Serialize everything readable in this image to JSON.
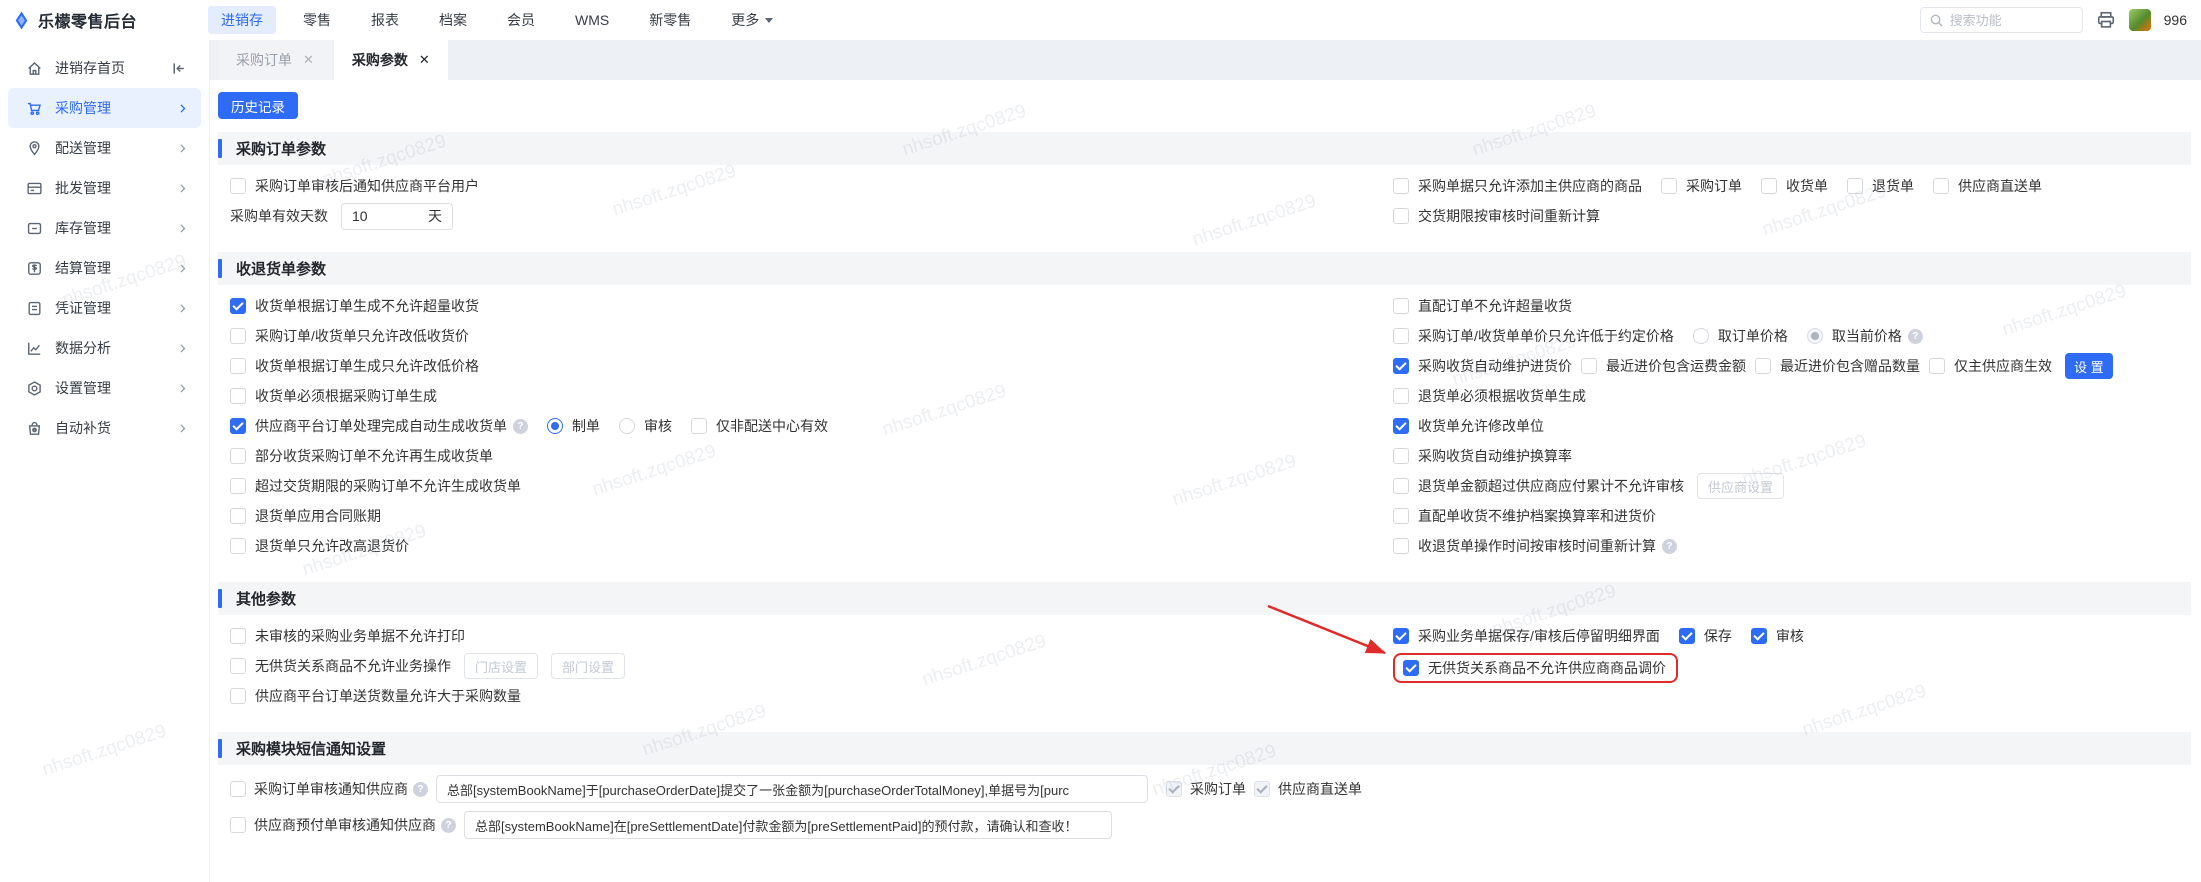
{
  "watermark": {
    "text": "nhsoft.zqc0829"
  },
  "colors": {
    "accent": "#2e6bf6",
    "highlight_red": "#e12a2a",
    "active_bg": "#e3edff"
  },
  "topbar": {
    "brand": "乐檬零售后台",
    "nav": [
      {
        "label": "进销存",
        "active": true
      },
      {
        "label": "零售",
        "active": false
      },
      {
        "label": "报表",
        "active": false
      },
      {
        "label": "档案",
        "active": false
      },
      {
        "label": "会员",
        "active": false
      },
      {
        "label": "WMS",
        "active": false
      },
      {
        "label": "新零售",
        "active": false
      },
      {
        "label": "更多",
        "active": false
      }
    ],
    "search_placeholder": "搜索功能",
    "username": "996"
  },
  "sidebar": {
    "items": [
      {
        "label": "进销存首页",
        "active": false
      },
      {
        "label": "采购管理",
        "active": true
      },
      {
        "label": "配送管理",
        "active": false
      },
      {
        "label": "批发管理",
        "active": false
      },
      {
        "label": "库存管理",
        "active": false
      },
      {
        "label": "结算管理",
        "active": false
      },
      {
        "label": "凭证管理",
        "active": false
      },
      {
        "label": "数据分析",
        "active": false
      },
      {
        "label": "设置管理",
        "active": false
      },
      {
        "label": "自动补货",
        "active": false
      }
    ]
  },
  "tabs": [
    {
      "label": "采购订单",
      "active": false
    },
    {
      "label": "采购参数",
      "active": true
    }
  ],
  "page": {
    "history_btn": "历史记录",
    "s1": {
      "title": "采购订单参数",
      "l0": {
        "label": "采购订单审核后通知供应商平台用户",
        "checked": false
      },
      "l1": {
        "label": "采购单有效天数",
        "value": "10",
        "suffix": "天"
      },
      "r0": {
        "label": "采购单据只允许添加主供应商的商品",
        "checked": false,
        "sub0": {
          "label": "采购订单",
          "checked": false
        },
        "sub1": {
          "label": "收货单",
          "checked": false
        },
        "sub2": {
          "label": "退货单",
          "checked": false
        },
        "sub3": {
          "label": "供应商直送单",
          "checked": false
        }
      },
      "r1": {
        "label": "交货期限按审核时间重新计算",
        "checked": false
      }
    },
    "s2": {
      "title": "收退货单参数",
      "l0": {
        "label": "收货单根据订单生成不允许超量收货",
        "checked": true
      },
      "l1": {
        "label": "采购订单/收货单只允许改低收货价",
        "checked": false
      },
      "l2": {
        "label": "收货单根据订单生成只允许改低价格",
        "checked": false
      },
      "l3": {
        "label": "收货单必须根据采购订单生成",
        "checked": false
      },
      "l4": {
        "label": "供应商平台订单处理完成自动生成收货单",
        "checked": true,
        "radio0": {
          "label": "制单",
          "selected": true
        },
        "radio1": {
          "label": "审核",
          "selected": false
        },
        "sub0": {
          "label": "仅非配送中心有效",
          "checked": false
        }
      },
      "l5": {
        "label": "部分收货采购订单不允许再生成收货单",
        "checked": false
      },
      "l6": {
        "label": "超过交货期限的采购订单不允许生成收货单",
        "checked": false
      },
      "l7": {
        "label": "退货单应用合同账期",
        "checked": false
      },
      "l8": {
        "label": "退货单只允许改高退货价",
        "checked": false
      },
      "r0": {
        "label": "直配订单不允许超量收货",
        "checked": false
      },
      "r1": {
        "label": "采购订单/收货单单价只允许低于约定价格",
        "checked": false,
        "radio0": {
          "label": "取订单价格",
          "selected": false
        },
        "radio1": {
          "label": "取当前价格",
          "selected": true
        }
      },
      "r2": {
        "label": "采购收货自动维护进货价",
        "checked": true,
        "sub0": {
          "label": "最近进价包含运费金额",
          "checked": false
        },
        "sub1": {
          "label": "最近进价包含赠品数量",
          "checked": false
        },
        "sub2": {
          "label": "仅主供应商生效",
          "checked": false
        },
        "btn": "设 置"
      },
      "r3": {
        "label": "退货单必须根据收货单生成",
        "checked": false
      },
      "r4": {
        "label": "收货单允许修改单位",
        "checked": true
      },
      "r5": {
        "label": "采购收货自动维护换算率",
        "checked": false
      },
      "r6": {
        "label": "退货单金额超过供应商应付累计不允许审核",
        "checked": false,
        "btn": "供应商设置"
      },
      "r7": {
        "label": "直配单收货不维护档案换算率和进货价",
        "checked": false
      },
      "r8": {
        "label": "收退货单操作时间按审核时间重新计算",
        "checked": false
      }
    },
    "s3": {
      "title": "其他参数",
      "l0": {
        "label": "未审核的采购业务单据不允许打印",
        "checked": false
      },
      "l1": {
        "label": "无供货关系商品不允许业务操作",
        "checked": false,
        "btn0": "门店设置",
        "btn1": "部门设置"
      },
      "l2": {
        "label": "供应商平台订单送货数量允许大于采购数量",
        "checked": false
      },
      "r0": {
        "label": "采购业务单据保存/审核后停留明细界面",
        "checked": true,
        "sub0": {
          "label": "保存",
          "checked": true
        },
        "sub1": {
          "label": "审核",
          "checked": true
        }
      },
      "r1": {
        "label": "无供货关系商品不允许供应商商品调价",
        "checked": true
      }
    },
    "s4": {
      "title": "采购模块短信通知设置",
      "row0": {
        "label": "采购订单审核通知供应商",
        "checked": false,
        "input": "总部[systemBookName]于[purchaseOrderDate]提交了一张金额为[purchaseOrderTotalMoney],单据号为[purc",
        "sub0": {
          "label": "采购订单",
          "checked": true
        },
        "sub1": {
          "label": "供应商直送单",
          "checked": true
        }
      },
      "row1": {
        "label": "供应商预付单审核通知供应商",
        "checked": false,
        "input": "总部[systemBookName]在[preSettlementDate]付款金额为[preSettlementPaid]的预付款，请确认和查收！"
      }
    }
  }
}
